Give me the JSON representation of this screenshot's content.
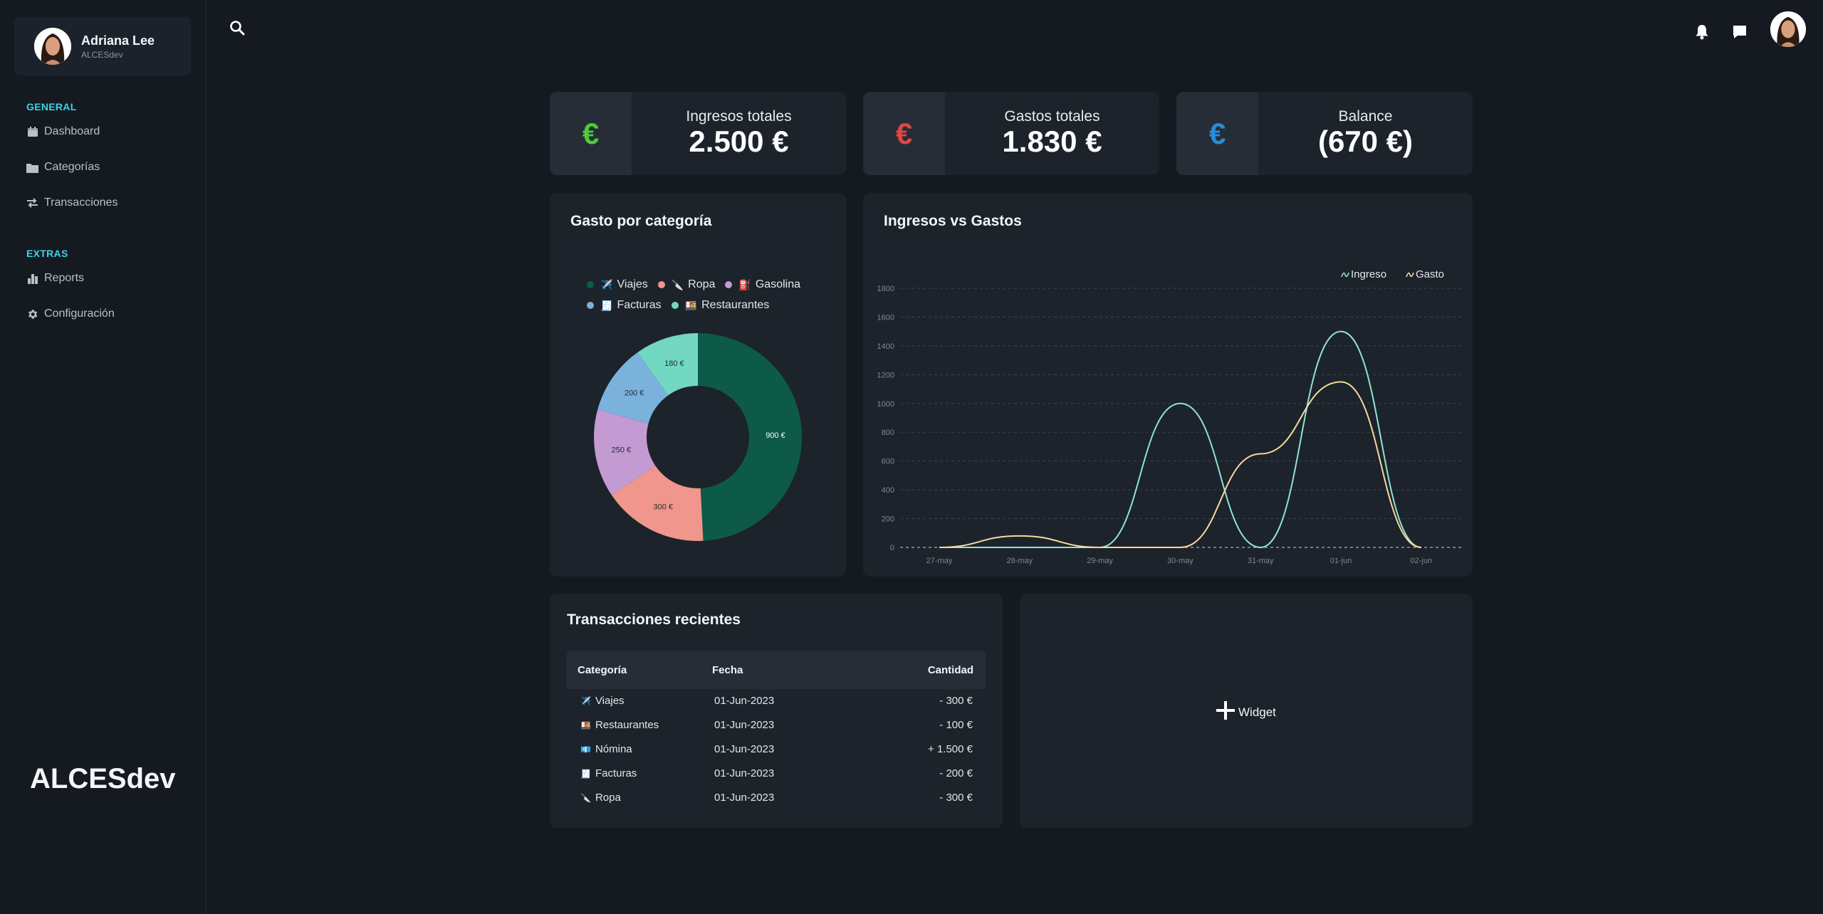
{
  "user": {
    "name": "Adriana Lee",
    "handle": "ALCESdev"
  },
  "sidebar": {
    "general_title": "GENERAL",
    "extras_title": "EXTRAS",
    "items": [
      {
        "label": "Dashboard",
        "icon": "calendar-icon"
      },
      {
        "label": "Categorías",
        "icon": "folder-icon"
      },
      {
        "label": "Transacciones",
        "icon": "transfer-icon"
      },
      {
        "label": "Reports",
        "icon": "bar-chart-icon"
      },
      {
        "label": "Configuración",
        "icon": "gear-icon"
      }
    ],
    "brand": "ALCESdev"
  },
  "stats": [
    {
      "label": "Ingresos totales",
      "value": "2.500 €",
      "symbol": "€",
      "color": "#4ccb3c"
    },
    {
      "label": "Gastos totales",
      "value": "1.830 €",
      "symbol": "€",
      "color": "#e04545"
    },
    {
      "label": "Balance",
      "value": "(670 €)",
      "symbol": "€",
      "color": "#2a8bd8"
    }
  ],
  "category_chart": {
    "title": "Gasto por categoría",
    "legend": [
      {
        "label": "Viajes",
        "emoji": "✈️",
        "color": "#0c5a47"
      },
      {
        "label": "Ropa",
        "emoji": "🔪",
        "color": "#f0968c"
      },
      {
        "label": "Gasolina",
        "emoji": "⛽",
        "color": "#c49ad3"
      },
      {
        "label": "Facturas",
        "emoji": "🧾",
        "color": "#7ab2dc"
      },
      {
        "label": "Restaurantes",
        "emoji": "🍱",
        "color": "#72d8c2"
      }
    ]
  },
  "line_chart_title": "Ingresos vs Gastos",
  "chart_data": [
    {
      "type": "pie",
      "title": "Gasto por categoría",
      "categories": [
        "Viajes",
        "Ropa",
        "Gasolina",
        "Facturas",
        "Restaurantes"
      ],
      "values": [
        900,
        300,
        250,
        200,
        180
      ],
      "labels": [
        "900 €",
        "300 €",
        "250 €",
        "200 €",
        "180 €"
      ],
      "donut": true,
      "legend": "top"
    },
    {
      "type": "line",
      "title": "Ingresos vs Gastos",
      "x": [
        "27-may",
        "28-may",
        "29-may",
        "30-may",
        "31-may",
        "01-jun",
        "02-jun"
      ],
      "series": [
        {
          "name": "Ingreso",
          "color": "#8fe3d2",
          "values": [
            0,
            0,
            0,
            1000,
            0,
            1500,
            0
          ]
        },
        {
          "name": "Gasto",
          "color": "#f7d9a0",
          "values": [
            0,
            80,
            0,
            0,
            650,
            1150,
            0
          ]
        }
      ],
      "ylim": [
        0,
        1800
      ],
      "yticks": [
        0,
        200,
        400,
        600,
        800,
        1000,
        1200,
        1400,
        1600,
        1800
      ],
      "grid": true,
      "legend": "top-right"
    }
  ],
  "transactions": {
    "title": "Transacciones recientes",
    "headers": {
      "category": "Categoría",
      "date": "Fecha",
      "amount": "Cantidad"
    },
    "rows": [
      {
        "emoji": "✈️",
        "category": "Viajes",
        "date": "01-Jun-2023",
        "amount": "- 300 €"
      },
      {
        "emoji": "🍱",
        "category": "Restaurantes",
        "date": "01-Jun-2023",
        "amount": "- 100 €"
      },
      {
        "emoji": "💶",
        "category": "Nómina",
        "date": "01-Jun-2023",
        "amount": "+ 1.500 €"
      },
      {
        "emoji": "🧾",
        "category": "Facturas",
        "date": "01-Jun-2023",
        "amount": "- 200 €"
      },
      {
        "emoji": "🔪",
        "category": "Ropa",
        "date": "01-Jun-2023",
        "amount": "- 300 €"
      }
    ]
  },
  "widget": {
    "label": "Widget"
  }
}
